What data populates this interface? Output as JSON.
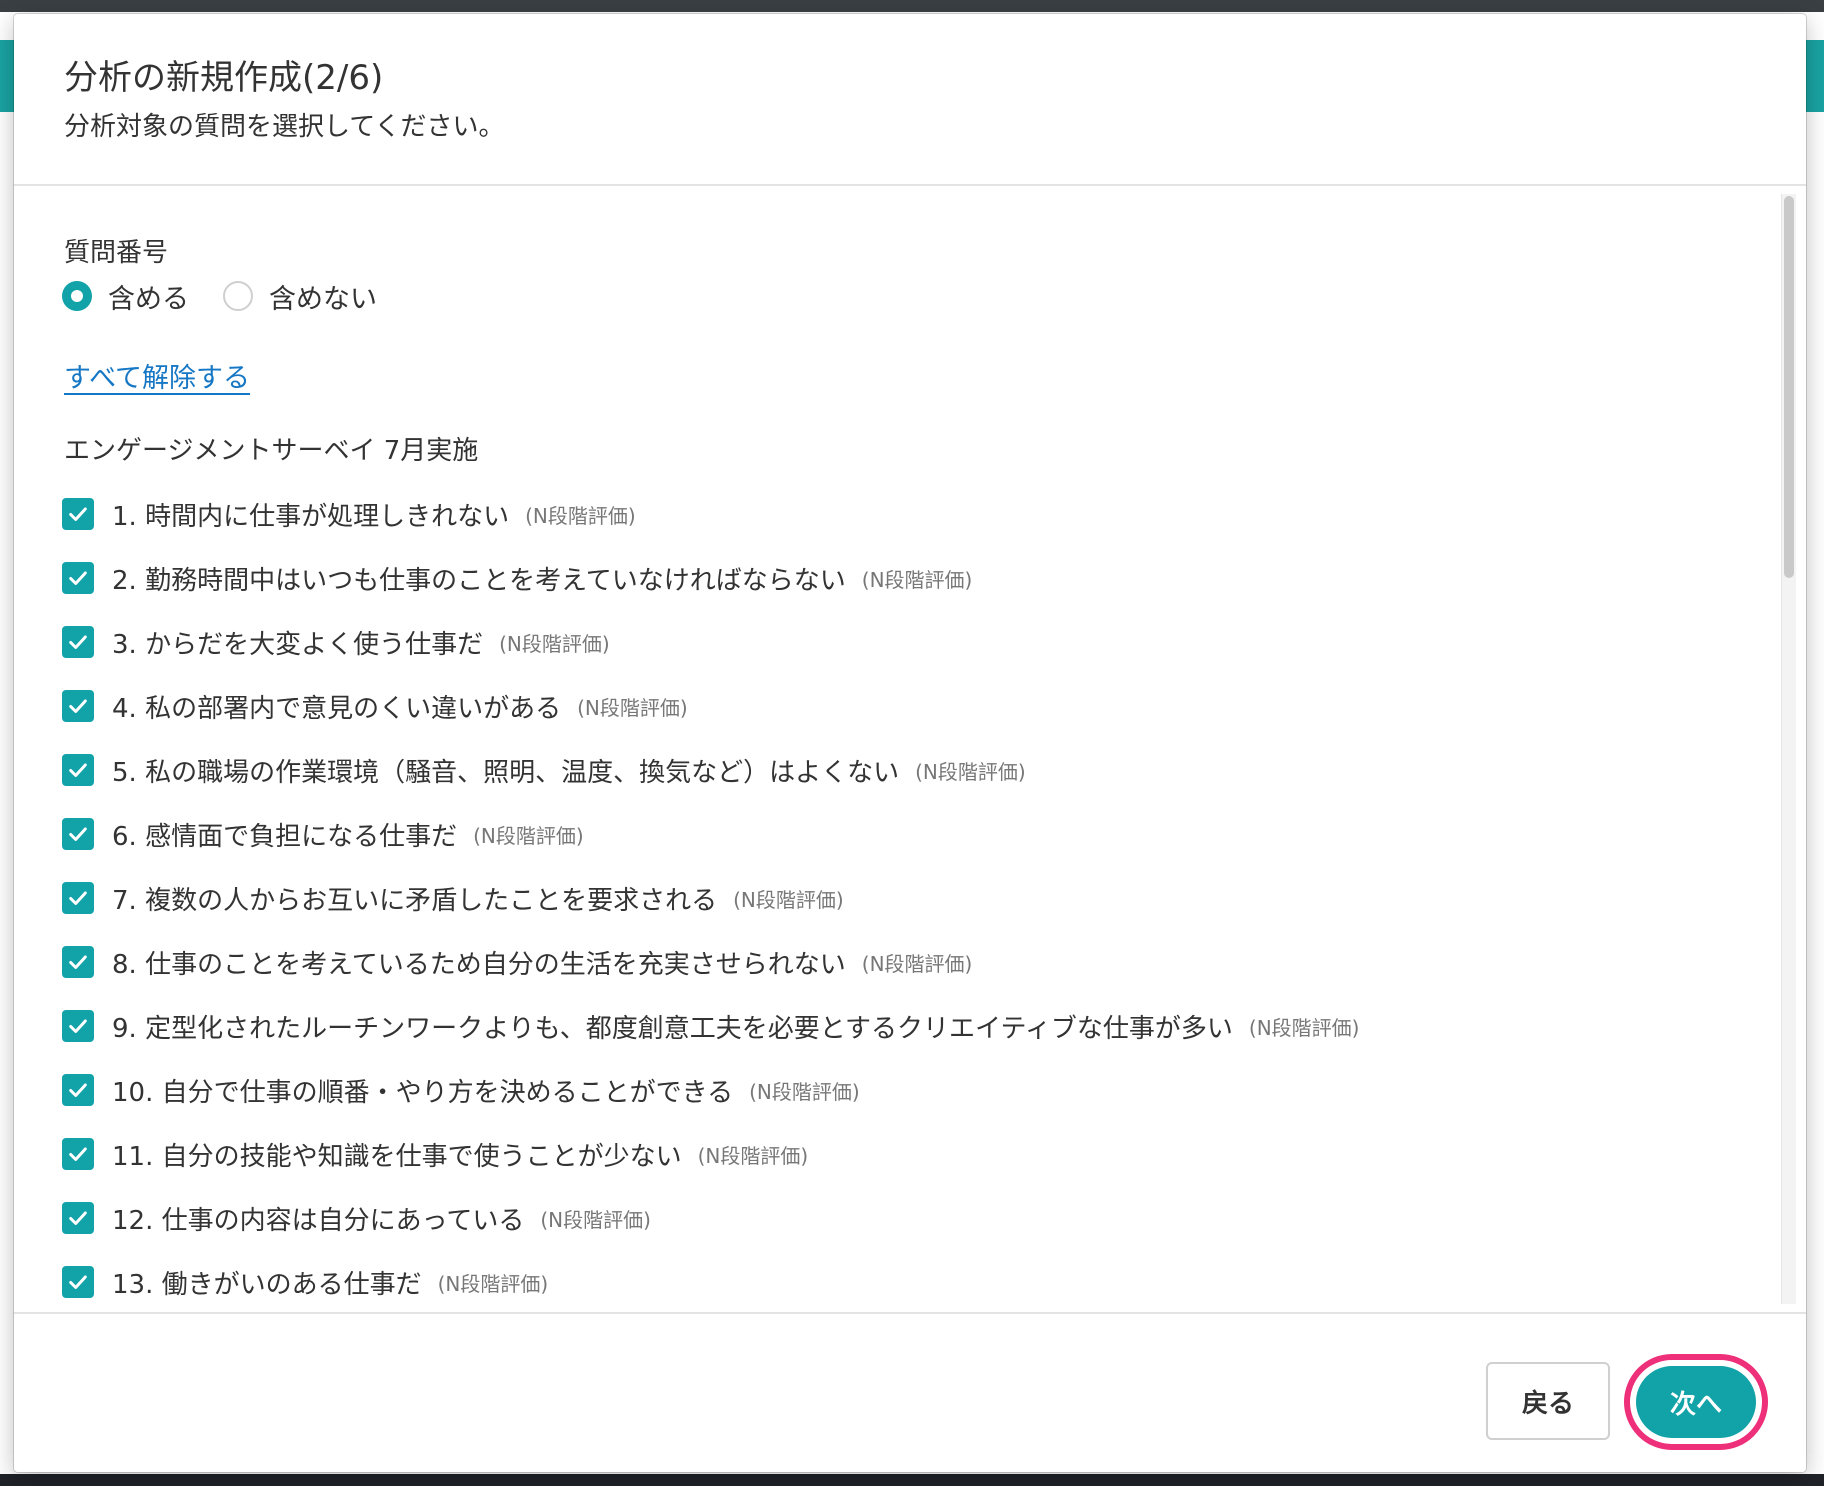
{
  "modal": {
    "title": "分析の新規作成(2/6)",
    "subtitle": "分析対象の質問を選択してください。"
  },
  "question_number": {
    "label": "質問番号",
    "options": [
      {
        "label": "含める",
        "selected": true
      },
      {
        "label": "含めない",
        "selected": false
      }
    ]
  },
  "clear_all_label": "すべて解除する",
  "survey_name": "エンゲージメントサーベイ 7月実施",
  "question_type_label": "(N段階評価)",
  "questions": [
    {
      "text": "1. 時間内に仕事が処理しきれない",
      "type": "(N段階評価)",
      "checked": true
    },
    {
      "text": "2. 勤務時間中はいつも仕事のことを考えていなければならない",
      "type": "(N段階評価)",
      "checked": true
    },
    {
      "text": "3. からだを大変よく使う仕事だ",
      "type": "(N段階評価)",
      "checked": true
    },
    {
      "text": "4. 私の部署内で意見のくい違いがある",
      "type": "(N段階評価)",
      "checked": true
    },
    {
      "text": "5. 私の職場の作業環境（騒音、照明、温度、換気など）はよくない",
      "type": "(N段階評価)",
      "checked": true
    },
    {
      "text": "6. 感情面で負担になる仕事だ",
      "type": "(N段階評価)",
      "checked": true
    },
    {
      "text": "7. 複数の人からお互いに矛盾したことを要求される",
      "type": "(N段階評価)",
      "checked": true
    },
    {
      "text": "8. 仕事のことを考えているため自分の生活を充実させられない",
      "type": "(N段階評価)",
      "checked": true
    },
    {
      "text": "9. 定型化されたルーチンワークよりも、都度創意工夫を必要とするクリエイティブな仕事が多い",
      "type": "(N段階評価)",
      "checked": true
    },
    {
      "text": "10. 自分で仕事の順番・やり方を決めることができる",
      "type": "(N段階評価)",
      "checked": true
    },
    {
      "text": "11. 自分の技能や知識を仕事で使うことが少ない",
      "type": "(N段階評価)",
      "checked": true
    },
    {
      "text": "12. 仕事の内容は自分にあっている",
      "type": "(N段階評価)",
      "checked": true
    },
    {
      "text": "13. 働きがいのある仕事だ",
      "type": "(N段階評価)",
      "checked": true
    }
  ],
  "footer": {
    "back_label": "戻る",
    "next_label": "次へ"
  },
  "colors": {
    "accent": "#12a3a8",
    "link": "#1677c4",
    "highlight_ring": "#ee2f7a"
  }
}
